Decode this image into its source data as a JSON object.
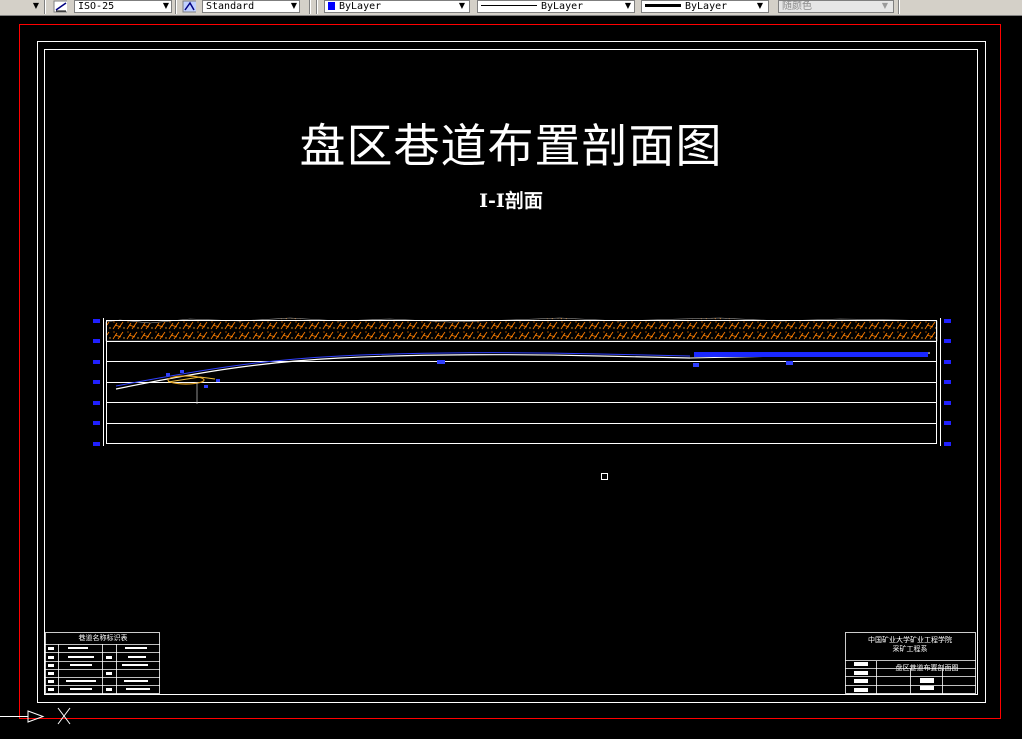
{
  "toolbar": {
    "dim_style": "ISO-25",
    "text_style": "Standard",
    "layer_color": "ByLayer",
    "linetype": "ByLayer",
    "lineweight": "ByLayer",
    "plot_style": "随颜色"
  },
  "drawing": {
    "title": "盘区巷道布置剖面图",
    "subtitle": "I-I剖面",
    "legend_table_title": "巷道名称标识表",
    "title_block": {
      "university": "中国矿业大学矿业工程学院",
      "department": "采矿工程系",
      "drawing_name": "盘区巷道布置剖面图"
    }
  },
  "colors": {
    "background": "#000000",
    "frame": "#ffffff",
    "viewport_border": "#ff0000",
    "strata_fill": "#ff7f00",
    "roadway": "#0000ff",
    "toolbar_bg": "#d4d0c8"
  },
  "icons": [
    "dimension-style-icon",
    "text-style-icon",
    "color-swatch-icon",
    "ucs-icon"
  ]
}
